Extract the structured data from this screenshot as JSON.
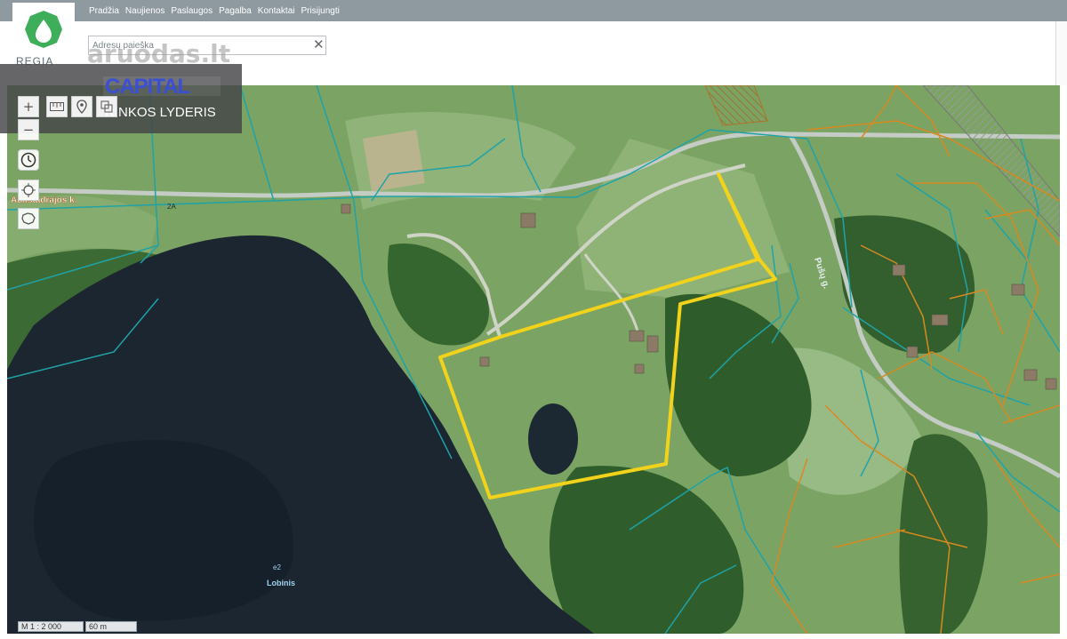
{
  "nav": [
    "Pradžia",
    "Naujienos",
    "Paslaugos",
    "Pagalba",
    "Kontaktai",
    "Prisijungti"
  ],
  "logo": {
    "text": "REGIA"
  },
  "search": {
    "placeholder": "Adresų paieška",
    "clear_icon": "close-icon"
  },
  "watermark": "aruodas.lt",
  "ad": {
    "brand": "CAPITAL",
    "slogan": "RINKOS LYDERIS"
  },
  "tools": {
    "zoom_in": "+",
    "zoom_out": "−",
    "measure_icon": "ruler-icon",
    "pin_icon": "pin-icon",
    "layers_icon": "layers-icon",
    "history_icon": "clock-icon",
    "locate_icon": "crosshair-icon",
    "region_icon": "lithuania-map-icon"
  },
  "map_labels": {
    "village": "Aukštadrajos k.",
    "road_code": "2A",
    "street": "Pušų g.",
    "lake_code": "e2",
    "lake_name": "Lobinis"
  },
  "scale": {
    "ratio": "M 1 : 2 000",
    "length": "60 m"
  },
  "colors": {
    "parcel_highlight": "#f2d21b",
    "cadastral_teal": "#1fa3a8",
    "cadastral_orange": "#d8891f",
    "lake": "#1b2630",
    "forest": "#2e5c2a",
    "meadow": "#7ea56a"
  }
}
